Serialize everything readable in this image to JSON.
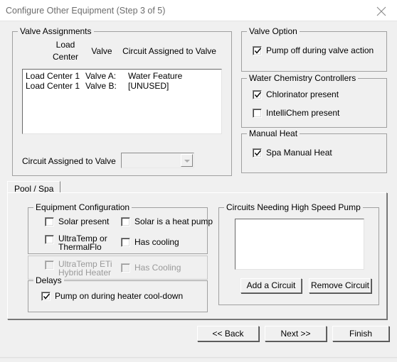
{
  "window": {
    "title": "Configure Other Equipment (Step 3 of 5)",
    "close_icon": "close-icon"
  },
  "valve_assignments": {
    "legend": "Valve Assignments",
    "columns": [
      "Load",
      "Center",
      "Valve",
      "Circuit Assigned to Valve"
    ],
    "header_load": "Load",
    "header_center": "Center",
    "header_valve": "Valve",
    "header_circuit": "Circuit Assigned to Valve",
    "rows": [
      {
        "load_center": "Load Center 1",
        "valve": "Valve A:",
        "circuit": "Water Feature"
      },
      {
        "load_center": "Load Center 1",
        "valve": "Valve B:",
        "circuit": "[UNUSED]"
      }
    ],
    "combo_label": "Circuit Assigned to Valve",
    "combo_value": "",
    "combo_enabled": false
  },
  "valve_option": {
    "legend": "Valve Option",
    "pump_off": {
      "label": "Pump off during valve action",
      "checked": true,
      "enabled": true
    }
  },
  "water_chemistry": {
    "legend": "Water Chemistry Controllers",
    "chlorinator": {
      "label": "Chlorinator present",
      "checked": true,
      "enabled": true
    },
    "intellichem": {
      "label": "IntelliChem present",
      "checked": false,
      "enabled": true
    }
  },
  "manual_heat": {
    "legend": "Manual Heat",
    "spa_manual_heat": {
      "label": "Spa Manual Heat",
      "checked": true,
      "enabled": true
    }
  },
  "tabs": [
    {
      "label": "Pool / Spa",
      "selected": true
    }
  ],
  "equipment_configuration": {
    "legend": "Equipment Configuration",
    "solar_present": {
      "label": "Solar present",
      "checked": false,
      "enabled": true
    },
    "solar_heat_pump": {
      "label": "Solar is a heat pump",
      "checked": false,
      "enabled": true
    },
    "ultratemp_line1": "UltraTemp or",
    "ultratemp_line2": "ThermalFlo",
    "ultratemp": {
      "checked": false,
      "enabled": true
    },
    "has_cooling": {
      "label": "Has cooling",
      "checked": false,
      "enabled": true
    }
  },
  "hybrid_panel": {
    "eti_line1": "UltraTemp ETi",
    "eti_line2": "Hybrid Heater",
    "eti": {
      "checked": false,
      "enabled": false
    },
    "has_cooling_2": {
      "label": "Has Cooling",
      "checked": false,
      "enabled": false
    }
  },
  "delays": {
    "legend": "Delays",
    "pump_on_cooldown": {
      "label": "Pump on during heater cool-down",
      "checked": true,
      "enabled": true
    }
  },
  "high_speed_pump": {
    "legend": "Circuits Needing High Speed Pump",
    "items": [],
    "add_button": "Add a Circuit",
    "remove_button": "Remove Circuit"
  },
  "navigation": {
    "back": "<< Back",
    "next": "Next >>",
    "finish": "Finish"
  }
}
